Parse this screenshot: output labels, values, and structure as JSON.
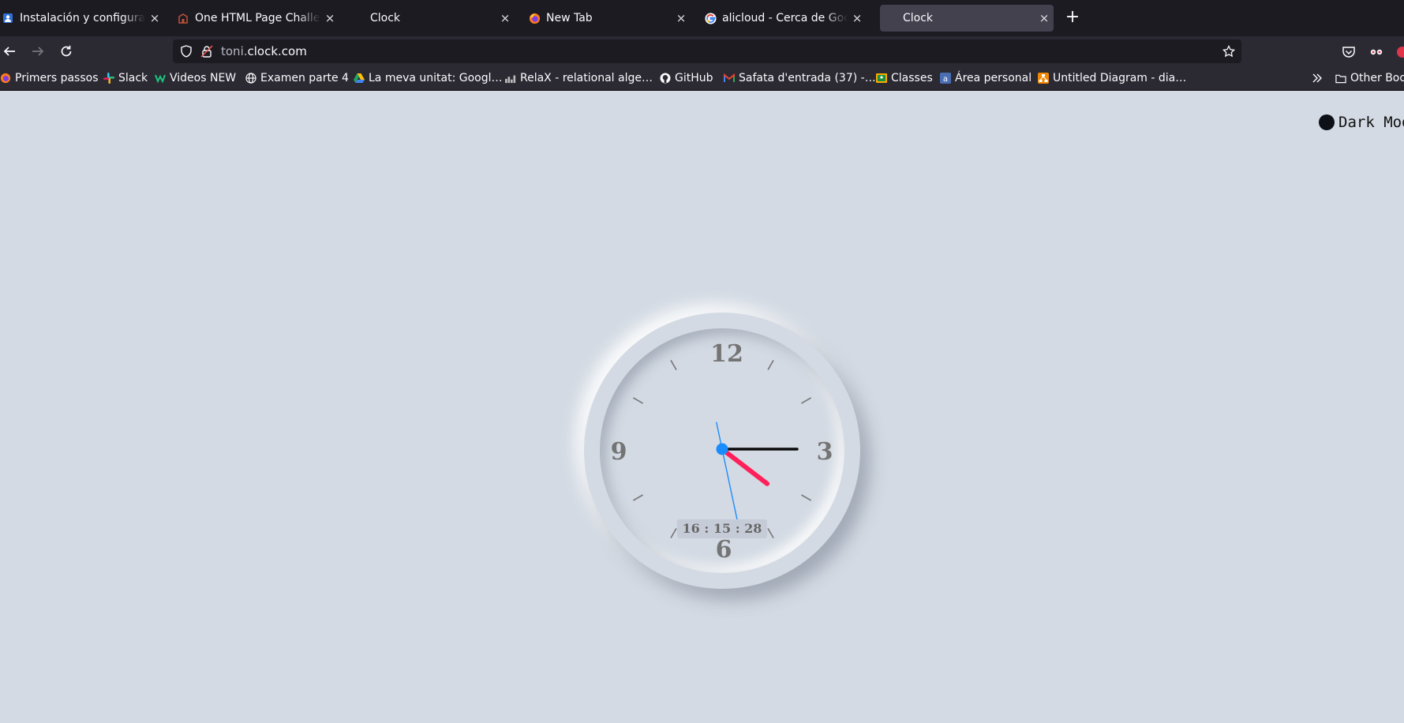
{
  "browser": {
    "tabs": [
      {
        "title": "Instalación y configuración",
        "active": false,
        "icon": "user-doc-icon"
      },
      {
        "title": "One HTML Page Challenge",
        "active": false,
        "icon": "building-icon"
      },
      {
        "title": "Clock",
        "active": false,
        "icon": ""
      },
      {
        "title": "New Tab",
        "active": false,
        "icon": "firefox-icon"
      },
      {
        "title": "alicloud - Cerca de Google",
        "active": false,
        "icon": "google-icon"
      },
      {
        "title": "Clock",
        "active": true,
        "icon": ""
      }
    ],
    "close_glyph": "×",
    "new_tab_glyph": "+",
    "url": {
      "subdomain": "toni.",
      "domain": "clock.com"
    },
    "bookmarks": [
      {
        "label": "Primers passos",
        "icon": "firefox-icon"
      },
      {
        "label": "Slack",
        "icon": "slack-icon"
      },
      {
        "label": "Videos NEW",
        "icon": "w-icon"
      },
      {
        "label": "Examen parte 4",
        "icon": "globe-icon"
      },
      {
        "label": "La meva unitat: Googl…",
        "icon": "drive-icon"
      },
      {
        "label": "RelaX - relational alge…",
        "icon": "relax-icon"
      },
      {
        "label": "GitHub",
        "icon": "github-icon"
      },
      {
        "label": "Safata d'entrada (37) -…",
        "icon": "gmail-icon"
      },
      {
        "label": "Classes",
        "icon": "classroom-icon"
      },
      {
        "label": "Área personal",
        "icon": "moodle-icon"
      },
      {
        "label": "Untitled Diagram - dia…",
        "icon": "drawio-icon"
      }
    ],
    "other_bookmarks": "Other Bookmarks"
  },
  "page": {
    "dark_mode_label": "Dark Mode",
    "clock": {
      "numerals": [
        "12",
        "3",
        "6",
        "9"
      ],
      "digital_time": "16 : 15 : 28",
      "hour_value": 4.25,
      "minute_value": 15,
      "second_value": 28
    }
  },
  "colors": {
    "page_bg": "#d3dae3",
    "hour_hand": "#ff1f5a",
    "minute_hand": "#0a0a0a",
    "second_hand": "#1a8cff",
    "center_dot": "#1a8cff",
    "numerals": "#747474"
  }
}
